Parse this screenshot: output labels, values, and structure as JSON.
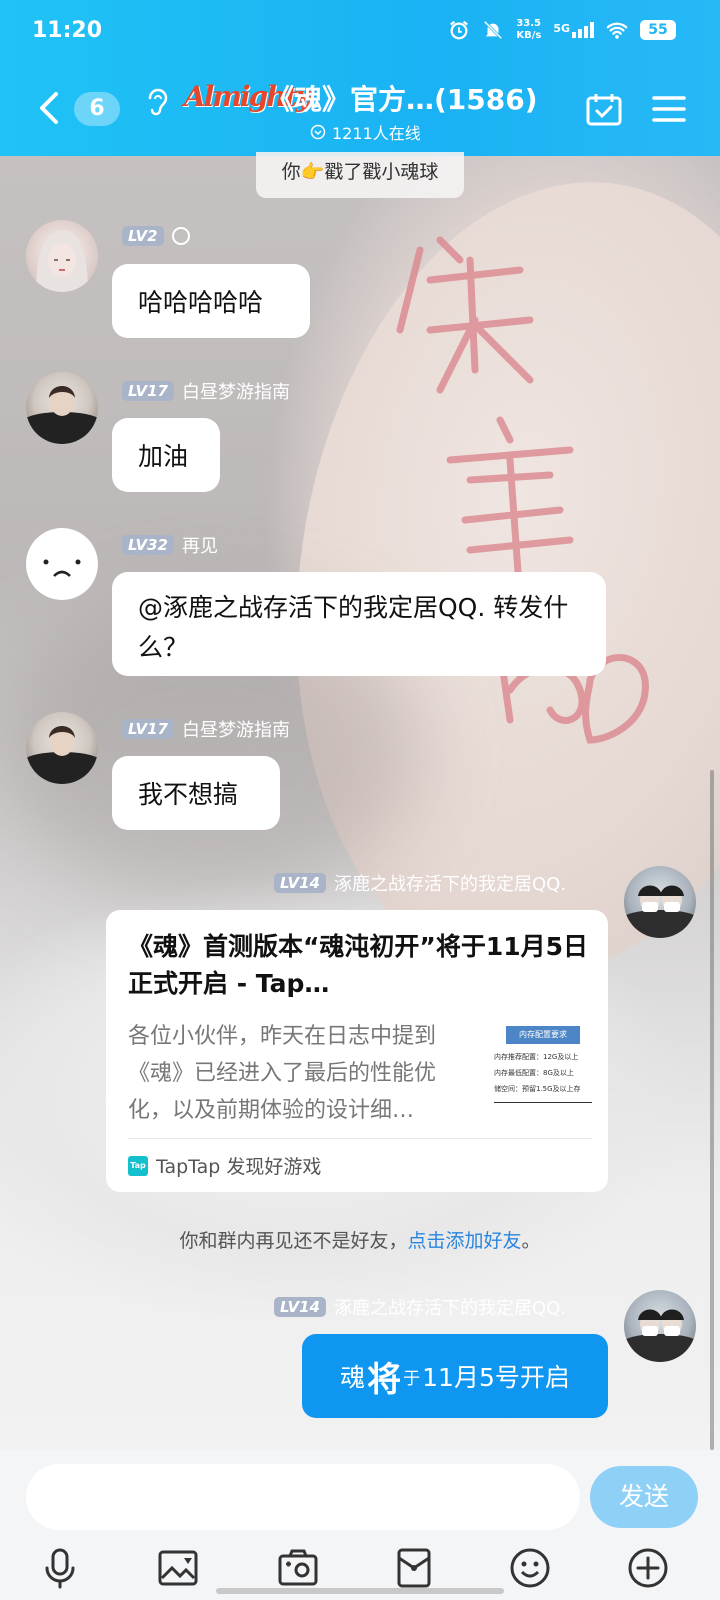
{
  "status_bar": {
    "time": "11:20",
    "net_speed": "33.5",
    "net_unit": "KB/s",
    "signal": "5G",
    "battery": "55"
  },
  "header": {
    "unread_count": "6",
    "logo_text": "Almighty",
    "title": "《魂》官方…(1586)",
    "online": "1211人在线"
  },
  "system_top": "你👉戳了戳小魂球",
  "messages": [
    {
      "level": "LV2",
      "name": "",
      "text": "哈哈哈哈哈"
    },
    {
      "level": "LV17",
      "name": "白昼梦游指南",
      "text": "加油"
    },
    {
      "level": "LV32",
      "name": "再见",
      "text": "@涿鹿之战存活下的我定居QQ. 转发什么？"
    },
    {
      "level": "LV17",
      "name": "白昼梦游指南",
      "text": "我不想搞"
    }
  ],
  "my_card": {
    "level": "LV14",
    "name": "涿鹿之战存活下的我定居QQ.",
    "card_title": "《魂》首测版本“魂沌初开”将于11月5日正式开启 - Tap…",
    "card_desc": "各位小伙伴，昨天在日志中提到《魂》已经进入了最后的性能优化，以及前期体验的设计细…",
    "thumb_header": "内存配置要求",
    "thumb_line1": "内存推荐配置：12G及以上",
    "thumb_line2": "内存最低配置：8G及以上",
    "thumb_line3": "储空间：预留1.5G及以上存",
    "source_icon": "Tap",
    "source": "TapTap 发现好游戏"
  },
  "notice": {
    "text": "你和群内再见还不是好友，",
    "link": "点击添加好友",
    "end": "。"
  },
  "my_message": {
    "level": "LV14",
    "name": "涿鹿之战存活下的我定居QQ.",
    "part1": "魂",
    "part2": "将",
    "part3": "于",
    "part4": "11月5号开启"
  },
  "input": {
    "placeholder": "",
    "send_label": "发送"
  },
  "colors": {
    "header_bg": "#1ab2f4",
    "my_bubble": "#0f96f0",
    "send_button": "#8fd0f7",
    "link": "#2a85e0"
  },
  "icons": [
    "back-icon",
    "ear-icon",
    "calendar-check-icon",
    "menu-icon",
    "mic-icon",
    "image-icon",
    "camera-icon",
    "red-packet-icon",
    "emoji-icon",
    "plus-icon"
  ]
}
